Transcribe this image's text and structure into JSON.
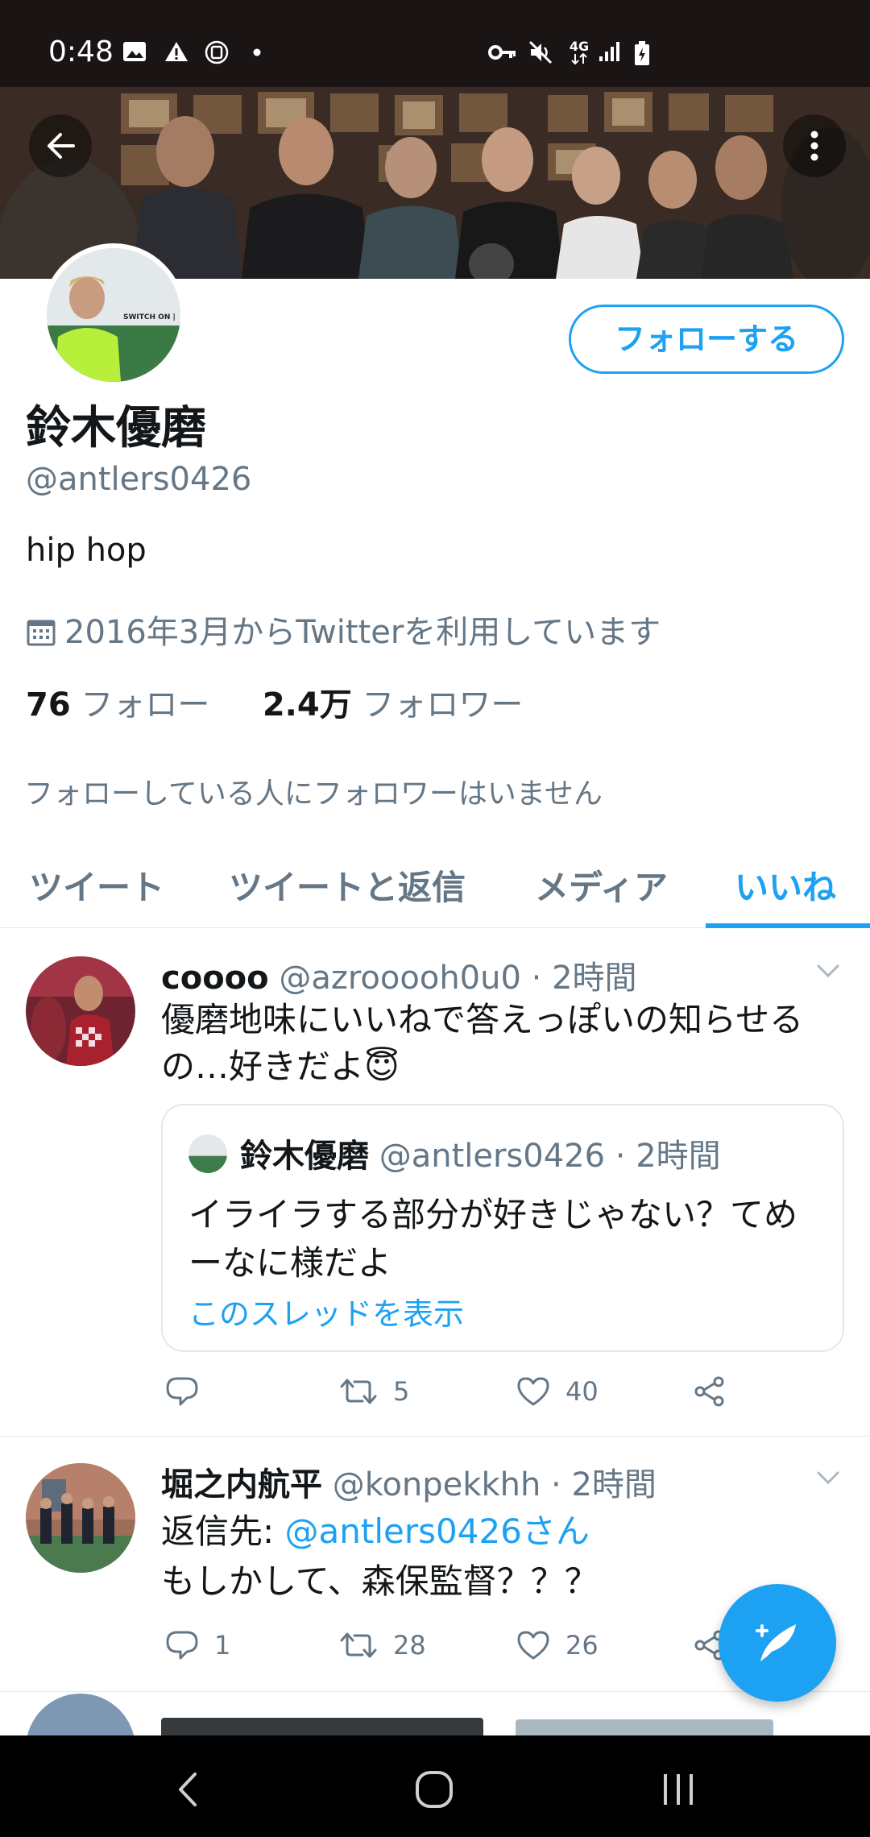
{
  "status_bar": {
    "time": "0:48",
    "icons": [
      "image-icon",
      "warning-icon",
      "screen-icon",
      "dot-icon",
      "vpn-key-icon",
      "mute-icon",
      "network-4g-icon",
      "signal-icon",
      "battery-icon"
    ],
    "network_label": "4G"
  },
  "profile": {
    "display_name": "鈴木優磨",
    "handle": "@antlers0426",
    "bio": "hip hop",
    "joined": "2016年3月からTwitterを利用しています",
    "following_count": "76",
    "following_label": "フォロー",
    "followers_count": "2.4万",
    "followers_label": "フォロワー",
    "no_mutual_followers": "フォローしている人にフォロワーはいません",
    "follow_button": "フォローする",
    "avatar_caption": "SWITCH ON |"
  },
  "tabs": [
    {
      "label": "ツイート",
      "active": false
    },
    {
      "label": "ツイートと返信",
      "active": false
    },
    {
      "label": "メディア",
      "active": false
    },
    {
      "label": "いいね",
      "active": true
    }
  ],
  "tweets": [
    {
      "name": "coooo",
      "handle": "@azrooooh0u0",
      "time": "· 2時間",
      "text": "優磨地味にいいねで答えっぽいの知らせるの…好きだよ😇",
      "quote": {
        "name": "鈴木優磨",
        "handle": "@antlers0426",
        "time": "· 2時間",
        "text": "イライラする部分が好きじゃない？てめーなに様だよ",
        "link": "このスレッドを表示"
      },
      "replies": "",
      "retweets": "5",
      "likes": "40"
    },
    {
      "name": "堀之内航平",
      "handle": "@konpekkhh",
      "time": "· 2時間",
      "reply_prefix": "返信先: ",
      "reply_mention": "@antlers0426さん",
      "text": "もしかして、森保監督？？？",
      "replies": "1",
      "retweets": "28",
      "likes": "26"
    }
  ],
  "colors": {
    "accent": "#1da1f2",
    "text_primary": "#14171a",
    "text_secondary": "#657786"
  }
}
